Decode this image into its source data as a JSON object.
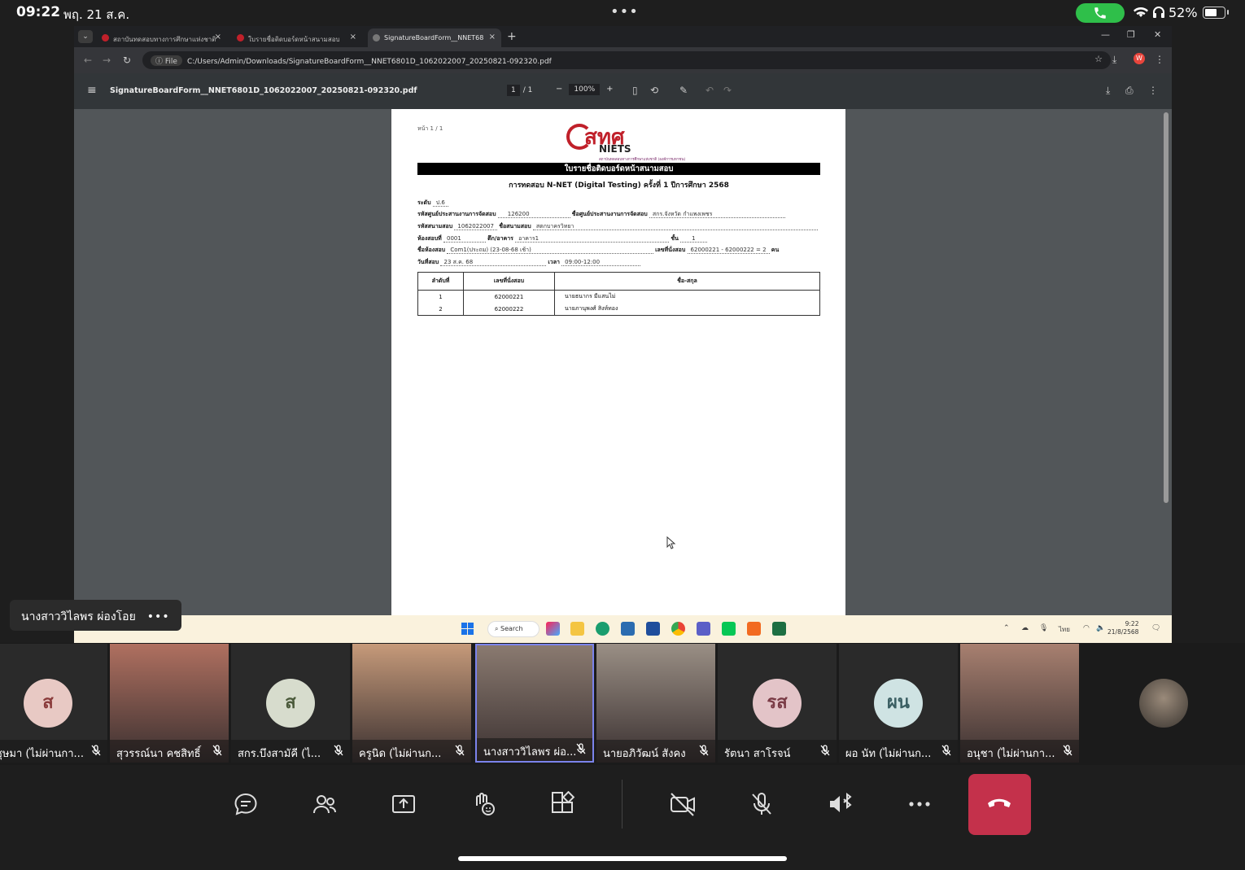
{
  "status_bar": {
    "time": "09:22",
    "date": "พฤ. 21 ส.ค.",
    "dots": "•••",
    "battery_pct": "52%",
    "battery_level": 0.52
  },
  "browser": {
    "tabs": [
      {
        "label": "สถาบันทดสอบทางการศึกษาแห่งชาติ",
        "active": false
      },
      {
        "label": "ใบรายชื่อติดบอร์ดหน้าสนามสอบ",
        "active": false
      },
      {
        "label": "SignatureBoardForm__NNET68",
        "active": true
      }
    ],
    "address_scheme": "File",
    "address": "C:/Users/Admin/Downloads/SignatureBoardForm__NNET6801D_1062022007_20250821-092320.pdf"
  },
  "pdf_viewer": {
    "filename": "SignatureBoardForm__NNET6801D_1062022007_20250821-092320.pdf",
    "page_current": "1",
    "page_total": "/ 1",
    "zoom": "100%"
  },
  "document": {
    "page_label": "หน้า 1 / 1",
    "logo_thai": "สทศ",
    "logo_en": "NIETS",
    "logo_sub": "สถาบันทดสอบทางการศึกษาแห่งชาติ (องค์การมหาชน)",
    "title": "ใบรายชื่อติดบอร์ดหน้าสนามสอบ",
    "subtitle": "การทดสอบ N-NET (Digital Testing) ครั้งที่ 1 ปีการศึกษา 2568",
    "level_label": "ระดับ",
    "level_value": "ป.6",
    "center_code_label": "รหัสศูนย์ประสานงานการจัดสอบ",
    "center_code_value": "126200",
    "center_name_label": "ชื่อศูนย์ประสานงานการจัดสอบ",
    "center_name_value": "สกร.จังหวัด กำแพงเพชร",
    "field_code_label": "รหัสสนามสอบ",
    "field_code_value": "1062022007",
    "field_name_label": "ชื่อสนามสอบ",
    "field_name_value": "สตกบาครวิทยา",
    "room_label": "ห้องสอบที่",
    "room_value": "0001",
    "building_label": "ตึก/อาคาร",
    "building_value": "อาคาร1",
    "floor_label": "ชั้น",
    "floor_value": "1",
    "room_name_label": "ชื่อห้องสอบ",
    "room_name_value": "Com1(ประถม) (23-08-68 เช้า)",
    "seat_label": "เลขที่นั่งสอบ",
    "seat_value": "62000221 - 62000222 = 2",
    "seat_unit": "คน",
    "date_label": "วันที่สอบ",
    "date_value": "23 ส.ค. 68",
    "time_label": "เวลา",
    "time_value": "09:00-12:00",
    "table_headers": [
      "ลำดับที่",
      "เลขที่นั่งสอบ",
      "ชื่อ-สกุล"
    ],
    "rows": [
      {
        "no": "1",
        "seat": "62000221",
        "name": "นายธนากร มีแสนไม่"
      },
      {
        "no": "2",
        "seat": "62000222",
        "name": "นายภานุพงศ์ สิงห์ทอง"
      }
    ]
  },
  "taskbar": {
    "search_label": "Search",
    "lang": "ไทย",
    "clock_time": "9:22",
    "clock_date": "21/8/2568"
  },
  "presenter": {
    "name": "นางสาววิไลพร ผ่องโอย",
    "more": "•••"
  },
  "participants": [
    {
      "name": "ชุษมา (ไม่ผ่านกา...",
      "initial": "ส",
      "avatar_color": "#e8c9c4",
      "text_color": "#8a3b3b",
      "video": false
    },
    {
      "name": "สุวรรณ์นา คชสิทธิ์",
      "initial": "",
      "avatar_color": "",
      "text_color": "",
      "video": true,
      "video_color": "#b07060"
    },
    {
      "name": "สกร.บึงสามัคี (ไ...",
      "initial": "ส",
      "avatar_color": "#d7dccd",
      "text_color": "#4b5a3b",
      "video": false
    },
    {
      "name": "ครูนิด (ไม่ผ่านก...",
      "initial": "",
      "avatar_color": "",
      "text_color": "",
      "video": true,
      "video_color": "#c69a7a"
    },
    {
      "name": "นางสาววิไลพร ผ่อ...",
      "initial": "",
      "avatar_color": "",
      "text_color": "",
      "video": true,
      "video_color": "#8a7a70",
      "speaking": true
    },
    {
      "name": "นายอภิวัฒน์ สังคง",
      "initial": "",
      "avatar_color": "",
      "text_color": "",
      "video": true,
      "video_color": "#9a8f85"
    },
    {
      "name": "รัตนา สาโรจน์",
      "initial": "รส",
      "avatar_color": "#e3c4c8",
      "text_color": "#7a3b46",
      "video": false
    },
    {
      "name": "ผอ นัท (ไม่ผ่านก...",
      "initial": "ผน",
      "avatar_color": "#cfe3e3",
      "text_color": "#3b5f63",
      "video": false
    },
    {
      "name": "อนุชา (ไม่ผ่านกา...",
      "initial": "",
      "avatar_color": "",
      "text_color": "",
      "video": true,
      "video_color": "#a88070"
    }
  ],
  "colors": {
    "teams_accent": "#7b83eb",
    "hangup_red": "#c4314b",
    "call_green": "#2fbf4a"
  },
  "controls": [
    "chat-icon",
    "people-icon",
    "share-icon",
    "react-icon",
    "apps-icon",
    "camera-off-icon",
    "mic-off-icon",
    "speaker-bluetooth-icon",
    "more-icon",
    "hangup-icon"
  ]
}
